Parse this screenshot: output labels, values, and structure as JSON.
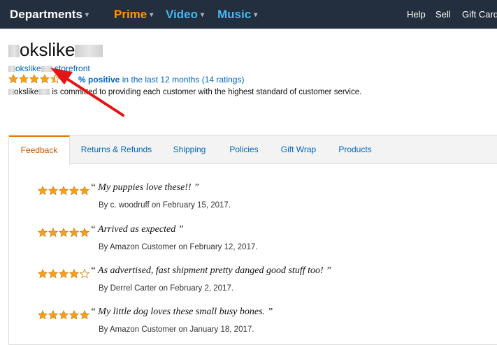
{
  "topnav": {
    "departments": "Departments",
    "prime": "Prime",
    "video": "Video",
    "music": "Music",
    "help": "Help",
    "sell": "Sell",
    "gift_cards": "Gift Cards",
    "colors": {
      "prime": "#ff9900",
      "video": "#44b8f0",
      "music": "#44b8f0"
    }
  },
  "seller": {
    "name_visible": "okslike",
    "storefront_visible_a": "okslike",
    "storefront_visible_b": "storefront",
    "rating_stars": 4.5,
    "rating_positive": "% positive",
    "rating_rest": " in the last 12 months (14 ratings)",
    "commit_visible_a": "okslike",
    "commit_visible_b": "is committed to providing each customer with the highest standard of customer service."
  },
  "tabs": [
    {
      "label": "Feedback",
      "active": true
    },
    {
      "label": "Returns & Refunds",
      "active": false
    },
    {
      "label": "Shipping",
      "active": false
    },
    {
      "label": "Policies",
      "active": false
    },
    {
      "label": "Gift Wrap",
      "active": false
    },
    {
      "label": "Products",
      "active": false
    }
  ],
  "feedback": [
    {
      "stars": 5,
      "quote": "“ My puppies love these!! ”",
      "by": "By c. woodruff on February 15, 2017."
    },
    {
      "stars": 5,
      "quote": "“ Arrived as expected ”",
      "by": "By Amazon Customer on February 12, 2017."
    },
    {
      "stars": 4,
      "quote": "“ As advertised, fast shipment pretty danged good stuff too! ”",
      "by": "By Derrel Carter on February 2, 2017."
    },
    {
      "stars": 5,
      "quote": "“ My little dog loves these small busy bones. ”",
      "by": "By Amazon Customer on January 18, 2017."
    }
  ],
  "colors": {
    "star_fill": "#f8a01c",
    "star_stroke": "#d07c00",
    "link": "#0066c0",
    "active_tab": "#c45500",
    "arrow": "#e21414"
  }
}
